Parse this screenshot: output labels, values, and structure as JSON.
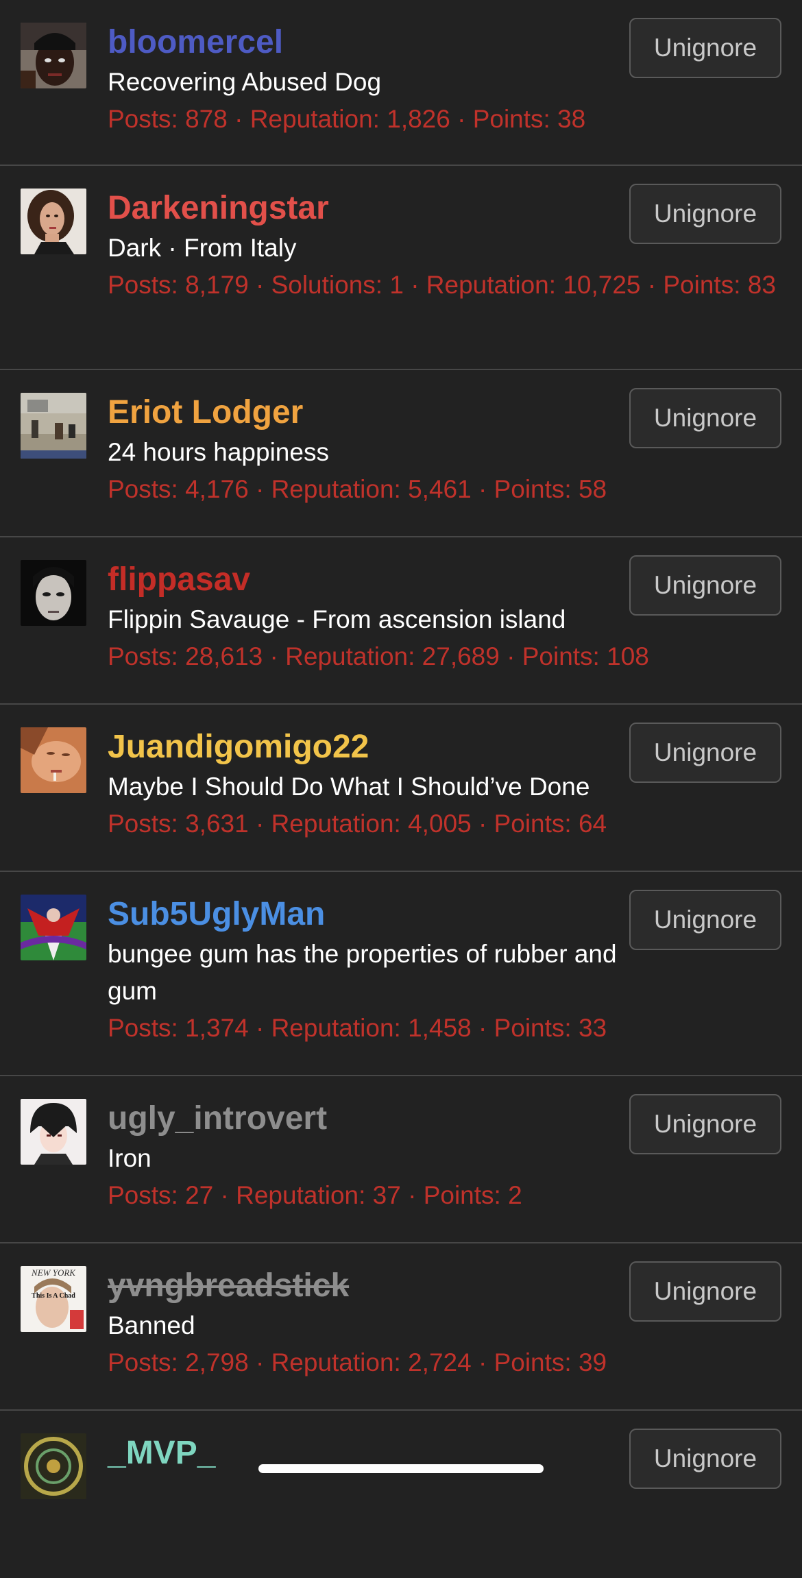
{
  "button_label": "Unignore",
  "users": [
    {
      "username": "bloomercel",
      "color": "#4e5bc4",
      "title": "Recovering Abused Dog",
      "stats": "Posts: 878 · Reputation: 1,826 · Points: 38",
      "banned": false,
      "avatar": "man-durag-avatar"
    },
    {
      "username": "Darkeningstar",
      "color": "#e2504a",
      "title": "Dark · From Italy",
      "stats": "Posts: 8,179 · Solutions: 1 · Reputation: 10,725 · Points: 83",
      "banned": false,
      "avatar": "woman-curly-hair-avatar"
    },
    {
      "username": "Eriot Lodger",
      "color": "#f0a340",
      "title": "24 hours happiness",
      "stats": "Posts: 4,176 · Reputation: 5,461 · Points: 58",
      "banned": false,
      "avatar": "street-scene-avatar"
    },
    {
      "username": "flippasav",
      "color": "#c42d27",
      "title": "Flippin Savauge - From ascension island",
      "stats": "Posts: 28,613 · Reputation: 27,689 · Points: 108",
      "banned": false,
      "avatar": "pale-face-avatar"
    },
    {
      "username": "Juandigomigo22",
      "color": "#f2c44a",
      "title": "Maybe I Should Do What I Should’ve Done",
      "stats": "Posts: 3,631 · Reputation: 4,005 · Points: 64",
      "banned": false,
      "avatar": "lying-face-avatar"
    },
    {
      "username": "Sub5UglyMan",
      "color": "#4b8fe3",
      "title": "bungee gum has the properties of rubber and gum",
      "stats": "Posts: 1,374 · Reputation: 1,458 · Points: 33",
      "banned": false,
      "avatar": "anime-villain-avatar"
    },
    {
      "username": "ugly_introvert",
      "color": "#8e8e8e",
      "title": "Iron",
      "stats": "Posts: 27 · Reputation: 37 · Points: 2",
      "banned": false,
      "avatar": "anime-boy-avatar"
    },
    {
      "username": "yvngbreadstick",
      "color": "#8e8e8e",
      "title": "Banned",
      "stats": "Posts: 2,798 · Reputation: 2,724 · Points: 39",
      "banned": true,
      "avatar": "magazine-cover-avatar"
    },
    {
      "username": "_MVP_",
      "color": "#7fd6c0",
      "title": "",
      "stats": "",
      "banned": false,
      "avatar": "ornament-avatar"
    }
  ],
  "magazine_text": {
    "masthead": "NEW YORK",
    "headline": "This Is A Chad"
  }
}
